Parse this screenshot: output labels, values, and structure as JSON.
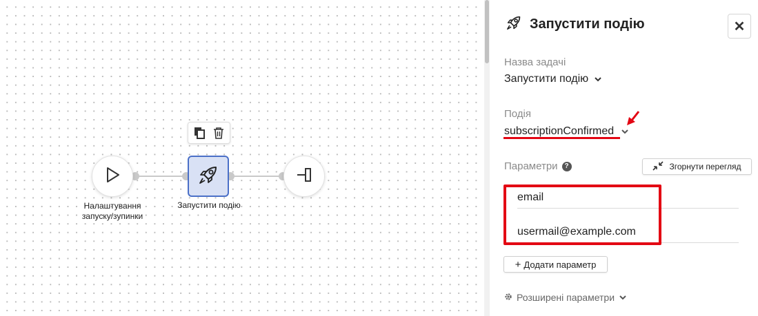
{
  "canvas": {
    "nodes": [
      {
        "id": "start",
        "label_line1": "Налаштування",
        "label_line2": "запуску/зупинки",
        "icon": "play-icon"
      },
      {
        "id": "trigger",
        "label": "Запустити подію",
        "icon": "rocket-icon"
      },
      {
        "id": "end",
        "icon": "exit-icon"
      }
    ],
    "toolbar": {
      "copy_icon": "copy-icon",
      "delete_icon": "trash-icon"
    }
  },
  "panel": {
    "title": "Запустити подію",
    "title_icon": "rocket-icon",
    "close_label": "✕",
    "task_name_label": "Назва задачі",
    "task_name_value": "Запустити подію",
    "event_label": "Подія",
    "event_value": "subscriptionConfirmed",
    "params_label": "Параметри",
    "help_icon_text": "?",
    "collapse_button_label": "Згорнути перегляд",
    "params": [
      {
        "value": "email"
      },
      {
        "value": "usermail@example.com"
      }
    ],
    "add_param_label": "Додати параметр",
    "add_param_prefix": "+",
    "advanced_label": "Розширені параметри"
  },
  "colors": {
    "accent_red": "#e30613",
    "node_selected_bg": "#d9e1f5",
    "node_selected_border": "#4a6fc7",
    "edge": "#c9c9c9"
  }
}
